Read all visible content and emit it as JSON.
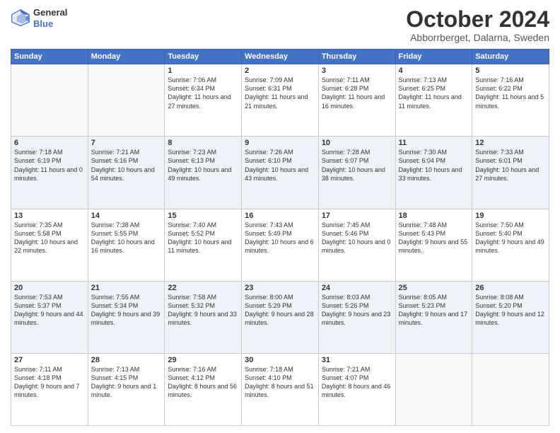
{
  "header": {
    "logo_line1": "General",
    "logo_line2": "Blue",
    "month": "October 2024",
    "location": "Abborrberget, Dalarna, Sweden"
  },
  "days_of_week": [
    "Sunday",
    "Monday",
    "Tuesday",
    "Wednesday",
    "Thursday",
    "Friday",
    "Saturday"
  ],
  "weeks": [
    [
      {
        "day": "",
        "detail": ""
      },
      {
        "day": "",
        "detail": ""
      },
      {
        "day": "1",
        "detail": "Sunrise: 7:06 AM\nSunset: 6:34 PM\nDaylight: 11 hours and 27 minutes."
      },
      {
        "day": "2",
        "detail": "Sunrise: 7:09 AM\nSunset: 6:31 PM\nDaylight: 11 hours and 21 minutes."
      },
      {
        "day": "3",
        "detail": "Sunrise: 7:11 AM\nSunset: 6:28 PM\nDaylight: 11 hours and 16 minutes."
      },
      {
        "day": "4",
        "detail": "Sunrise: 7:13 AM\nSunset: 6:25 PM\nDaylight: 11 hours and 11 minutes."
      },
      {
        "day": "5",
        "detail": "Sunrise: 7:16 AM\nSunset: 6:22 PM\nDaylight: 11 hours and 5 minutes."
      }
    ],
    [
      {
        "day": "6",
        "detail": "Sunrise: 7:18 AM\nSunset: 6:19 PM\nDaylight: 11 hours and 0 minutes."
      },
      {
        "day": "7",
        "detail": "Sunrise: 7:21 AM\nSunset: 6:16 PM\nDaylight: 10 hours and 54 minutes."
      },
      {
        "day": "8",
        "detail": "Sunrise: 7:23 AM\nSunset: 6:13 PM\nDaylight: 10 hours and 49 minutes."
      },
      {
        "day": "9",
        "detail": "Sunrise: 7:26 AM\nSunset: 6:10 PM\nDaylight: 10 hours and 43 minutes."
      },
      {
        "day": "10",
        "detail": "Sunrise: 7:28 AM\nSunset: 6:07 PM\nDaylight: 10 hours and 38 minutes."
      },
      {
        "day": "11",
        "detail": "Sunrise: 7:30 AM\nSunset: 6:04 PM\nDaylight: 10 hours and 33 minutes."
      },
      {
        "day": "12",
        "detail": "Sunrise: 7:33 AM\nSunset: 6:01 PM\nDaylight: 10 hours and 27 minutes."
      }
    ],
    [
      {
        "day": "13",
        "detail": "Sunrise: 7:35 AM\nSunset: 5:58 PM\nDaylight: 10 hours and 22 minutes."
      },
      {
        "day": "14",
        "detail": "Sunrise: 7:38 AM\nSunset: 5:55 PM\nDaylight: 10 hours and 16 minutes."
      },
      {
        "day": "15",
        "detail": "Sunrise: 7:40 AM\nSunset: 5:52 PM\nDaylight: 10 hours and 11 minutes."
      },
      {
        "day": "16",
        "detail": "Sunrise: 7:43 AM\nSunset: 5:49 PM\nDaylight: 10 hours and 6 minutes."
      },
      {
        "day": "17",
        "detail": "Sunrise: 7:45 AM\nSunset: 5:46 PM\nDaylight: 10 hours and 0 minutes."
      },
      {
        "day": "18",
        "detail": "Sunrise: 7:48 AM\nSunset: 5:43 PM\nDaylight: 9 hours and 55 minutes."
      },
      {
        "day": "19",
        "detail": "Sunrise: 7:50 AM\nSunset: 5:40 PM\nDaylight: 9 hours and 49 minutes."
      }
    ],
    [
      {
        "day": "20",
        "detail": "Sunrise: 7:53 AM\nSunset: 5:37 PM\nDaylight: 9 hours and 44 minutes."
      },
      {
        "day": "21",
        "detail": "Sunrise: 7:55 AM\nSunset: 5:34 PM\nDaylight: 9 hours and 39 minutes."
      },
      {
        "day": "22",
        "detail": "Sunrise: 7:58 AM\nSunset: 5:32 PM\nDaylight: 9 hours and 33 minutes."
      },
      {
        "day": "23",
        "detail": "Sunrise: 8:00 AM\nSunset: 5:29 PM\nDaylight: 9 hours and 28 minutes."
      },
      {
        "day": "24",
        "detail": "Sunrise: 8:03 AM\nSunset: 5:26 PM\nDaylight: 9 hours and 23 minutes."
      },
      {
        "day": "25",
        "detail": "Sunrise: 8:05 AM\nSunset: 5:23 PM\nDaylight: 9 hours and 17 minutes."
      },
      {
        "day": "26",
        "detail": "Sunrise: 8:08 AM\nSunset: 5:20 PM\nDaylight: 9 hours and 12 minutes."
      }
    ],
    [
      {
        "day": "27",
        "detail": "Sunrise: 7:11 AM\nSunset: 4:18 PM\nDaylight: 9 hours and 7 minutes."
      },
      {
        "day": "28",
        "detail": "Sunrise: 7:13 AM\nSunset: 4:15 PM\nDaylight: 9 hours and 1 minute."
      },
      {
        "day": "29",
        "detail": "Sunrise: 7:16 AM\nSunset: 4:12 PM\nDaylight: 8 hours and 56 minutes."
      },
      {
        "day": "30",
        "detail": "Sunrise: 7:18 AM\nSunset: 4:10 PM\nDaylight: 8 hours and 51 minutes."
      },
      {
        "day": "31",
        "detail": "Sunrise: 7:21 AM\nSunset: 4:07 PM\nDaylight: 8 hours and 46 minutes."
      },
      {
        "day": "",
        "detail": ""
      },
      {
        "day": "",
        "detail": ""
      }
    ]
  ]
}
